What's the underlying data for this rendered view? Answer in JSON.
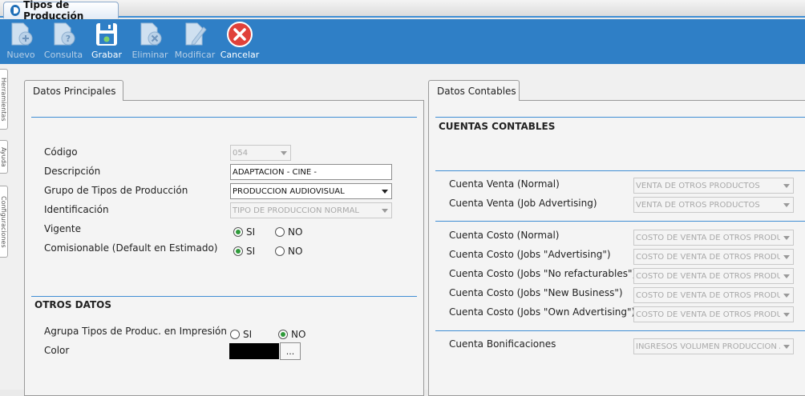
{
  "window": {
    "tab_title": "Tipos de Producción"
  },
  "toolbar": {
    "nuevo": "Nuevo",
    "consulta": "Consulta",
    "grabar": "Grabar",
    "eliminar": "Eliminar",
    "modificar": "Modificar",
    "cancelar": "Cancelar"
  },
  "side_tabs": [
    "Herramientas",
    "Ayuda",
    "Configuraciones"
  ],
  "principales": {
    "tab": "Datos Principales",
    "codigo_label": "Código",
    "codigo_value": "054",
    "descripcion_label": "Descripción",
    "descripcion_value": "ADAPTACION - CINE -",
    "grupo_label": "Grupo de Tipos de Producción",
    "grupo_value": "PRODUCCION AUDIOVISUAL",
    "identificacion_label": "Identificación",
    "identificacion_value": "TIPO DE PRODUCCIÓN NORMAL",
    "vigente_label": "Vigente",
    "comisionable_label": "Comisionable (Default en Estimado)",
    "si": "SI",
    "no": "NO",
    "otros_title": "OTROS DATOS",
    "agrupa_label": "Agrupa Tipos de Produc. en Impresión",
    "color_label": "Color",
    "color_button": "...",
    "color_value": "#000000"
  },
  "contables": {
    "tab": "Datos Contables",
    "title": "CUENTAS CONTABLES",
    "rows": [
      {
        "label": "Cuenta Venta (Normal)",
        "value": "VENTA DE OTROS PRODUCTOS"
      },
      {
        "label": "Cuenta Venta (Job Advertising)",
        "value": "VENTA DE OTROS PRODUCTOS"
      },
      {
        "label": "Cuenta Costo (Normal)",
        "value": "COSTO DE VENTA DE OTROS PRODUC"
      },
      {
        "label": "Cuenta Costo (Jobs \"Advertising\")",
        "value": "COSTO DE VENTA DE OTROS PRODUC"
      },
      {
        "label": "Cuenta Costo (Jobs \"No refacturables\")",
        "value": "COSTO DE VENTA DE OTROS PRODUC"
      },
      {
        "label": "Cuenta Costo (Jobs \"New Business\")",
        "value": "COSTO DE VENTA DE OTROS PRODUC"
      },
      {
        "label": "Cuenta Costo (Jobs \"Own Advertising\")",
        "value": "COSTO DE VENTA DE OTROS PRODUC"
      },
      {
        "label": "Cuenta Bonificaciones",
        "value": "INGRESOS VOLUMEN PRODUCCION A"
      }
    ]
  },
  "colors": {
    "toolbar": "#2f7fc6",
    "accent_line": "#3f8ed4",
    "cancel": "#e0413a",
    "radio_on": "#2f9a3a"
  }
}
